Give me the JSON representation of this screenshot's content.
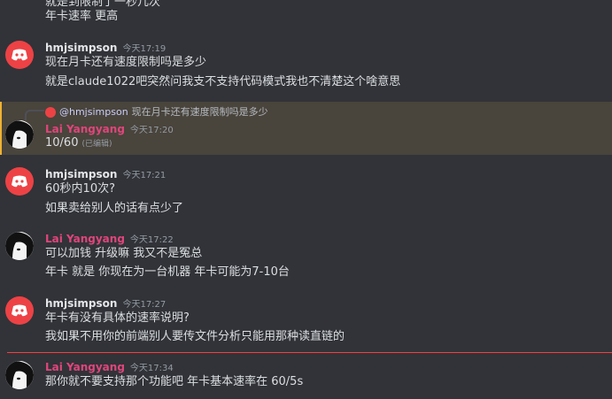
{
  "messages": [
    {
      "lines": [
        "就是到限制了一秒几次",
        "年卡速率 更高"
      ]
    },
    {
      "author": "hmjsimpson",
      "time": "今天17:19",
      "lines": [
        "现在月卡还有速度限制吗是多少",
        "就是claude1022吧突然问我支不支持代码模式我也不清楚这个啥意思"
      ]
    },
    {
      "author": "Lai Yangyang",
      "time": "今天17:20",
      "reply": {
        "author": "@hmjsimpson",
        "text": "现在月卡还有速度限制吗是多少"
      },
      "lines": [
        "10/60"
      ],
      "edited": "(已编辑)"
    },
    {
      "author": "hmjsimpson",
      "time": "今天17:21",
      "lines": [
        "60秒内10次?",
        "如果卖给别人的话有点少了"
      ]
    },
    {
      "author": "Lai Yangyang",
      "time": "今天17:22",
      "lines": [
        "可以加钱 升级嘛  我又不是冤总",
        "年卡 就是 你现在为一台机器 年卡可能为7-10台"
      ]
    },
    {
      "author": "hmjsimpson",
      "time": "今天17:27",
      "lines": [
        "年卡有没有具体的速率说明?",
        "我如果不用你的前端别人要传文件分析只能用那种读直链的"
      ]
    },
    {
      "author": "Lai Yangyang",
      "time": "今天17:34",
      "lines": [
        "那你就不要支持那个功能吧  年卡基本速率在  60/5s"
      ]
    }
  ],
  "colors": {
    "background": "#313338",
    "discord_red": "#ed4245",
    "mention_highlight": "#49443c",
    "username_pink": "#e0457b"
  }
}
